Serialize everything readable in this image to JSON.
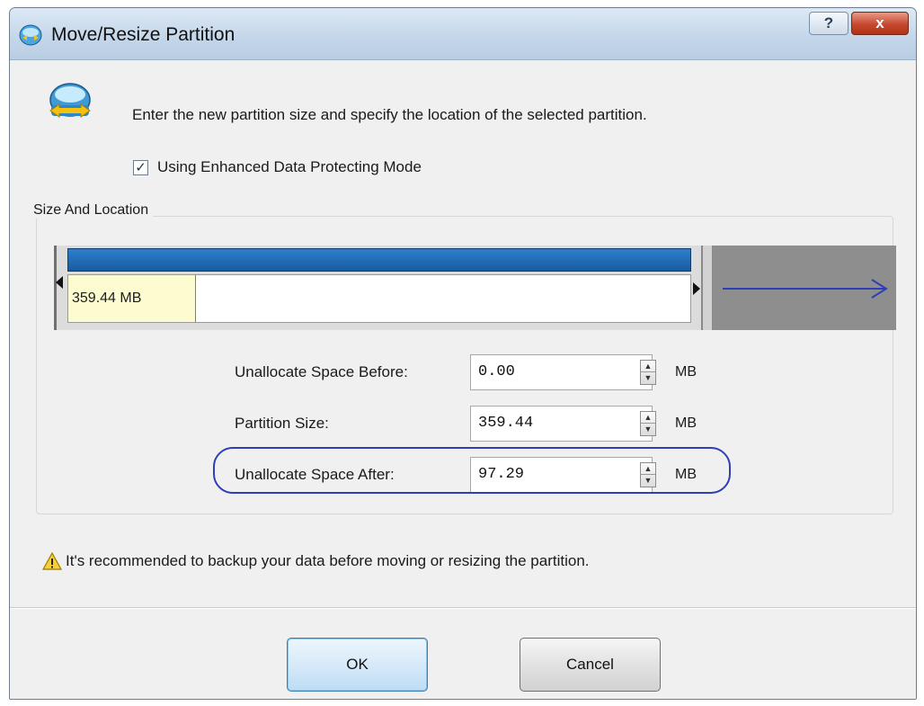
{
  "window": {
    "title": "Move/Resize Partition",
    "help_label": "?",
    "close_label": "x"
  },
  "instruction": "Enter the new partition size and specify the location of the selected partition.",
  "enhanced_mode": {
    "label": "Using Enhanced Data Protecting Mode",
    "checked": true,
    "mark": "✓"
  },
  "size_location": {
    "group_title": "Size And Location",
    "bar_used_label": "359.44 MB",
    "partition_fraction": 0.787
  },
  "fields": [
    {
      "label": "Unallocate Space Before:",
      "value": "0.00",
      "unit": "MB"
    },
    {
      "label": "Partition Size:",
      "value": "359.44",
      "unit": "MB"
    },
    {
      "label": "Unallocate Space After:",
      "value": "97.29",
      "unit": "MB"
    }
  ],
  "warning": "It's recommended to backup your data before moving or resizing the partition.",
  "buttons": {
    "ok": "OK",
    "cancel": "Cancel"
  },
  "colors": {
    "partition_blue": "#1f6bb8",
    "used_fill": "#fdfcd0",
    "free_gray": "#8e8e8e",
    "highlight": "#2d3fb6",
    "arrow": "#2d3fb6"
  },
  "icons": {
    "title": "partition-app-icon",
    "header": "move-resize-icon",
    "warning": "warning-triangle-icon"
  }
}
